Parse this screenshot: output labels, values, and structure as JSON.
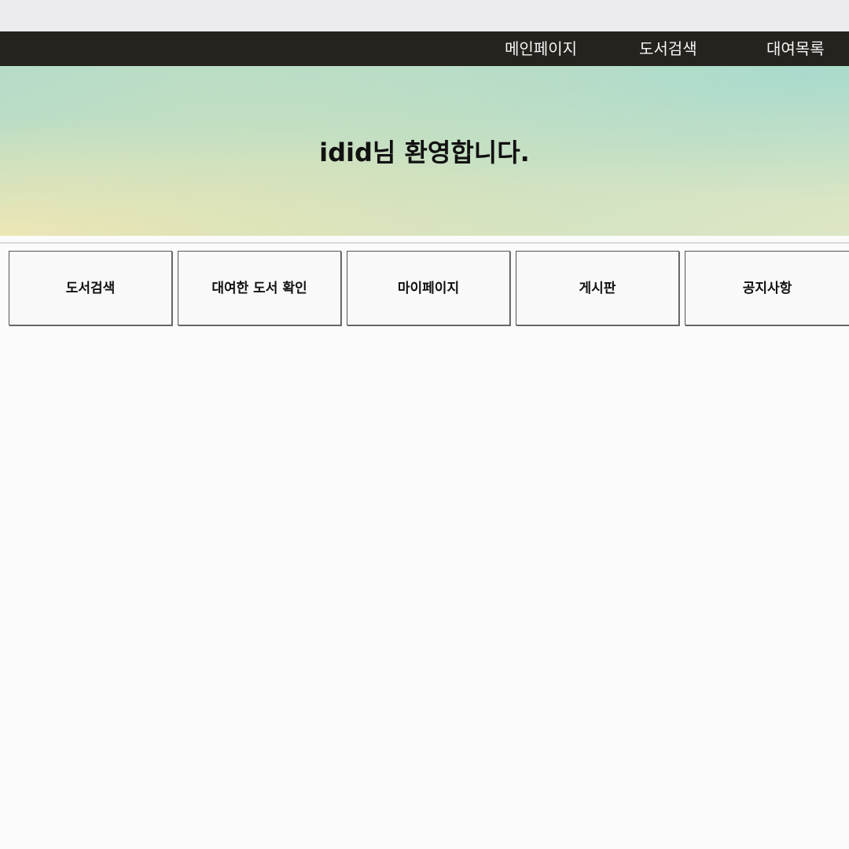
{
  "nav": {
    "items": [
      {
        "label": "메인페이지"
      },
      {
        "label": "도서검색"
      },
      {
        "label": "대여목록"
      }
    ]
  },
  "hero": {
    "title": "idid님 환영합니다."
  },
  "menu": {
    "buttons": [
      {
        "label": "도서검색"
      },
      {
        "label": "대여한 도서 확인"
      },
      {
        "label": "마이페이지"
      },
      {
        "label": "게시판"
      },
      {
        "label": "공지사항"
      }
    ]
  },
  "colors": {
    "navbar_bg": "#26231f",
    "hero_gradient_start": "#b5dcc8",
    "hero_gradient_end": "#dde6c5"
  }
}
